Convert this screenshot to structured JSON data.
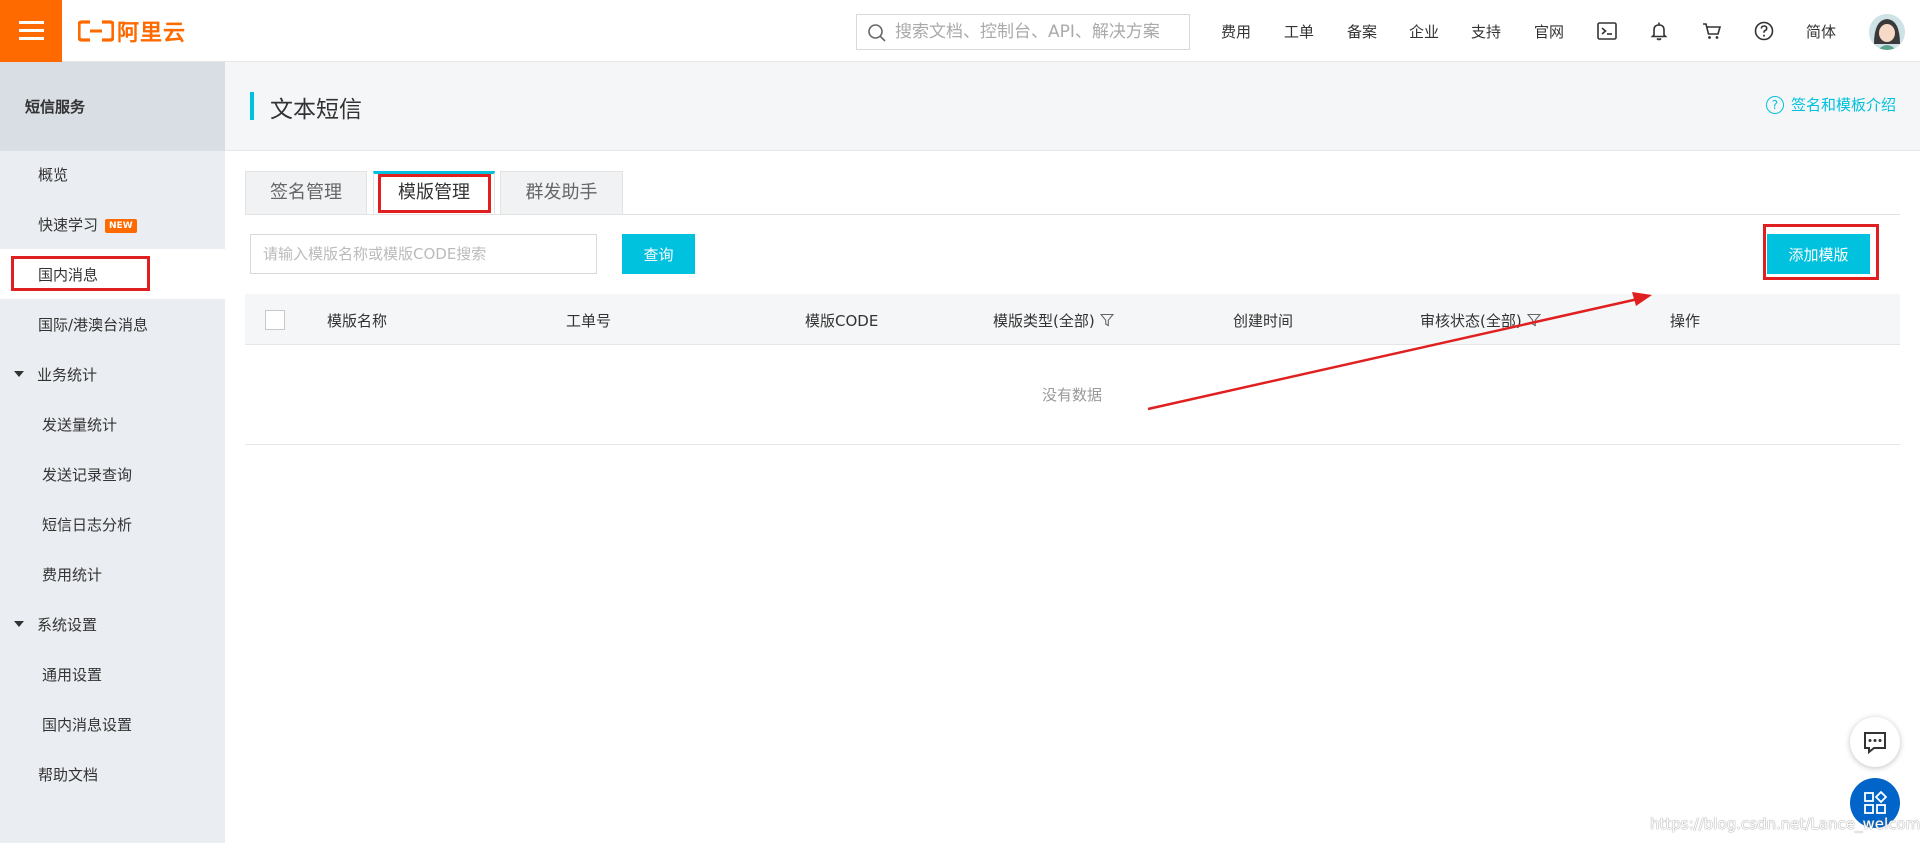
{
  "brand": {
    "logo_text": "阿里云",
    "accent": "#ff6a00",
    "primary": "#00c1de"
  },
  "topbar": {
    "search_placeholder": "搜索文档、控制台、API、解决方案",
    "links": [
      "费用",
      "工单",
      "备案",
      "企业",
      "支持",
      "官网"
    ],
    "lang": "简体"
  },
  "sidebar": {
    "header": "短信服务",
    "items": [
      {
        "label": "概览"
      },
      {
        "label": "快速学习",
        "badge": "NEW"
      },
      {
        "label": "国内消息"
      },
      {
        "label": "国际/港澳台消息"
      },
      {
        "label": "业务统计"
      },
      {
        "label": "发送量统计"
      },
      {
        "label": "发送记录查询"
      },
      {
        "label": "短信日志分析"
      },
      {
        "label": "费用统计"
      },
      {
        "label": "系统设置"
      },
      {
        "label": "通用设置"
      },
      {
        "label": "国内消息设置"
      },
      {
        "label": "帮助文档"
      }
    ]
  },
  "page": {
    "title": "文本短信",
    "help_link": "签名和模板介绍",
    "tabs": [
      {
        "label": "签名管理"
      },
      {
        "label": "模版管理"
      },
      {
        "label": "群发助手"
      }
    ],
    "query_placeholder": "请输入模版名称或模版CODE搜索",
    "query_button": "查询",
    "add_button": "添加模版",
    "columns": [
      "模版名称",
      "工单号",
      "模版CODE",
      "模版类型(全部)",
      "创建时间",
      "审核状态(全部)",
      "操作"
    ],
    "empty_text": "没有数据"
  },
  "watermark": "https://blog.csdn.net/Lance_welcome"
}
